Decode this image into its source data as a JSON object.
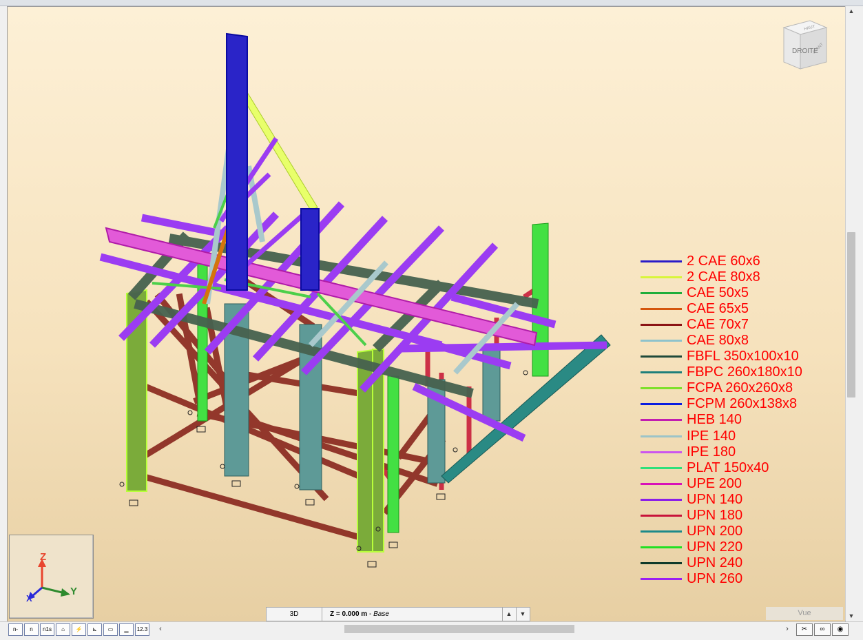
{
  "viewcube": {
    "face_front": "DROITE",
    "face_top": "HAUT",
    "face_side": "AVANT"
  },
  "legend": [
    {
      "label": "2 CAE 60x6",
      "color": "#2a1bc8"
    },
    {
      "label": "2 CAE 80x8",
      "color": "#d8f53a"
    },
    {
      "label": "CAE 50x5",
      "color": "#1fae3a"
    },
    {
      "label": "CAE 65x5",
      "color": "#d4560d"
    },
    {
      "label": "CAE 70x7",
      "color": "#8b1414"
    },
    {
      "label": "CAE 80x8",
      "color": "#8ec3cc"
    },
    {
      "label": "FBFL 350x100x10",
      "color": "#1f4a3a"
    },
    {
      "label": "FBPC 260x180x10",
      "color": "#1e7f7a"
    },
    {
      "label": "FCPA 260x260x8",
      "color": "#7ee02a"
    },
    {
      "label": "FCPM 260x138x8",
      "color": "#0a1de0"
    },
    {
      "label": "HEB 140",
      "color": "#c21cb0"
    },
    {
      "label": "IPE 140",
      "color": "#9cc4c8"
    },
    {
      "label": "IPE 180",
      "color": "#cc55ee"
    },
    {
      "label": "PLAT 150x40",
      "color": "#2ee07a"
    },
    {
      "label": "UPE 200",
      "color": "#d812b8"
    },
    {
      "label": "UPN 140",
      "color": "#8a1ee8"
    },
    {
      "label": "UPN 180",
      "color": "#c8143a"
    },
    {
      "label": "UPN 200",
      "color": "#1c8a8a"
    },
    {
      "label": "UPN 220",
      "color": "#22e022"
    },
    {
      "label": "UPN 240",
      "color": "#0f3a2a"
    },
    {
      "label": "UPN 260",
      "color": "#9b1ef2"
    }
  ],
  "axes": {
    "z": "Z",
    "y": "Y",
    "x": "X"
  },
  "viewbar": {
    "mode": "3D",
    "z_label": "Z = 0.000 m",
    "z_sep": " - ",
    "z_level": "Base"
  },
  "vue_tab": "Vue",
  "toolbar": [
    "n-",
    "n",
    "n1s",
    "⌂",
    "⚡",
    "⊾",
    "▭",
    "▁",
    "12.3"
  ],
  "icons": {
    "scroll_up": "up-arrow-icon",
    "scroll_down": "down-arrow-icon",
    "scroll_left": "left-arrow-icon",
    "scroll_right": "right-arrow-icon"
  }
}
